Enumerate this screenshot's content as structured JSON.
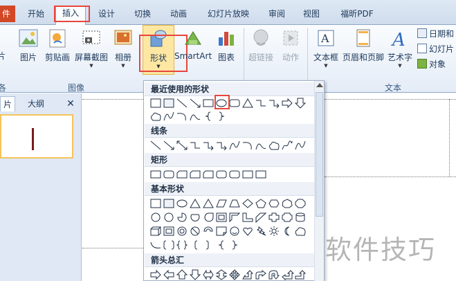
{
  "tabs": [
    {
      "label": "件"
    },
    {
      "label": "开始"
    },
    {
      "label": "插入"
    },
    {
      "label": "设计"
    },
    {
      "label": "切换"
    },
    {
      "label": "动画"
    },
    {
      "label": "幻灯片放映"
    },
    {
      "label": "审阅"
    },
    {
      "label": "视图"
    },
    {
      "label": "福昕PDF"
    }
  ],
  "ribbon": {
    "buttons": [
      {
        "label": "片"
      },
      {
        "label": "图片"
      },
      {
        "label": "剪贴画"
      },
      {
        "label": "屏幕截图"
      },
      {
        "label": "相册"
      },
      {
        "label": "形状"
      },
      {
        "label": "SmartArt"
      },
      {
        "label": "图表"
      },
      {
        "label": "超链接"
      },
      {
        "label": "动作"
      },
      {
        "label": "文本框"
      },
      {
        "label": "页眉和页脚"
      },
      {
        "label": "艺术字"
      }
    ],
    "small_buttons": [
      {
        "label": "日期和"
      },
      {
        "label": "幻灯片"
      },
      {
        "label": "对象"
      }
    ],
    "groups": {
      "g0": "各",
      "images": "图像",
      "text": "文本"
    }
  },
  "left_panel": {
    "tab_slides": "片",
    "tab_outline": "大纲",
    "close": "✕"
  },
  "gallery": {
    "sections": {
      "recent": "最近使用的形状",
      "lines": "线条",
      "rect": "矩形",
      "basic": "基本形状",
      "arrows": "箭头总汇"
    }
  },
  "watermark": "软件技巧",
  "colors": {
    "highlight": "#e8453c",
    "file_tab": "#d24726",
    "selected_button": "#fde7a2"
  }
}
